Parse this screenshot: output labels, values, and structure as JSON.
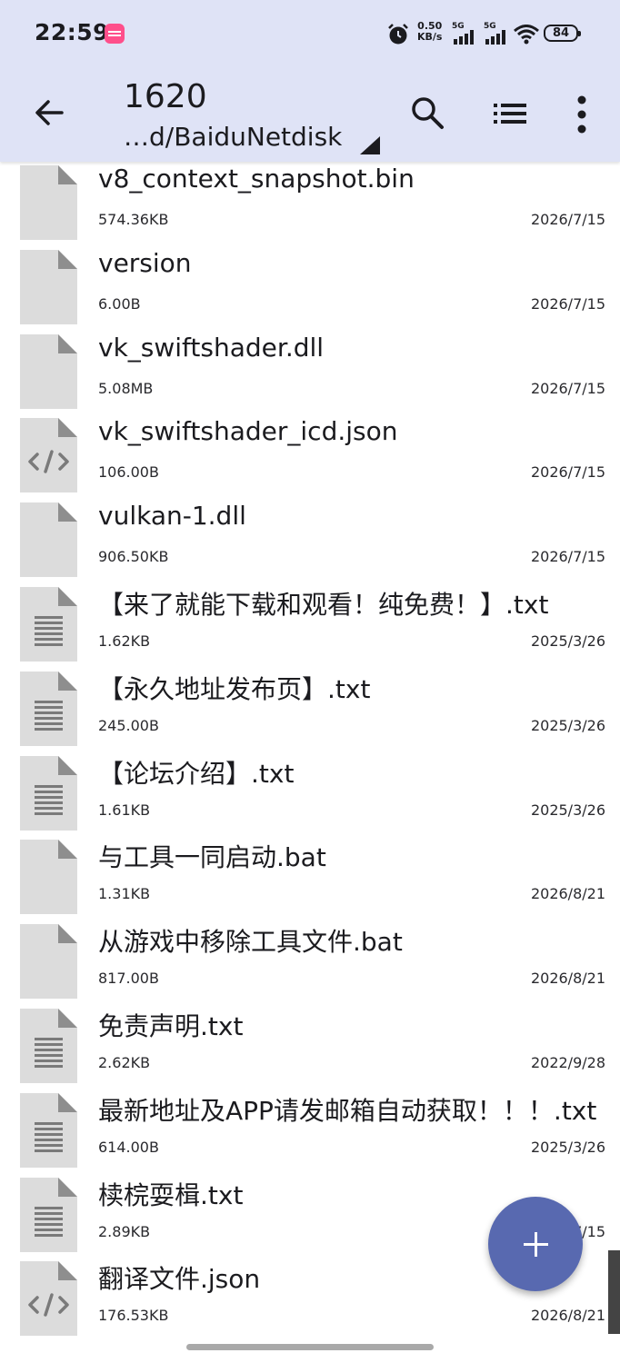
{
  "status_bar": {
    "time": "22:59",
    "net_speed_value": "0.50",
    "net_speed_unit": "KB/s",
    "sim1": "5G",
    "sim2": "5G",
    "battery": "84"
  },
  "toolbar": {
    "title": "1620",
    "path": "…d/BaiduNetdisk",
    "icons": [
      "back-arrow-icon",
      "search-icon",
      "list-view-icon",
      "more-vert-icon"
    ]
  },
  "files": [
    {
      "name": "v8_context_snapshot.bin",
      "size": "574.36KB",
      "date": "2026/7/15",
      "icon": "generic"
    },
    {
      "name": "version",
      "size": "6.00B",
      "date": "2026/7/15",
      "icon": "generic"
    },
    {
      "name": "vk_swiftshader.dll",
      "size": "5.08MB",
      "date": "2026/7/15",
      "icon": "generic"
    },
    {
      "name": "vk_swiftshader_icd.json",
      "size": "106.00B",
      "date": "2026/7/15",
      "icon": "code"
    },
    {
      "name": "vulkan-1.dll",
      "size": "906.50KB",
      "date": "2026/7/15",
      "icon": "generic"
    },
    {
      "name": "【来了就能下载和观看！纯免费！】.txt",
      "size": "1.62KB",
      "date": "2025/3/26",
      "icon": "text"
    },
    {
      "name": "【永久地址发布页】.txt",
      "size": "245.00B",
      "date": "2025/3/26",
      "icon": "text"
    },
    {
      "name": "【论坛介绍】.txt",
      "size": "1.61KB",
      "date": "2025/3/26",
      "icon": "text"
    },
    {
      "name": "与工具一同启动.bat",
      "size": "1.31KB",
      "date": "2026/8/21",
      "icon": "generic"
    },
    {
      "name": "从游戏中移除工具文件.bat",
      "size": "817.00B",
      "date": "2026/8/21",
      "icon": "generic"
    },
    {
      "name": "免责声明.txt",
      "size": "2.62KB",
      "date": "2022/9/28",
      "icon": "text"
    },
    {
      "name": "最新地址及APP请发邮箱自动获取！！！.txt",
      "size": "614.00B",
      "date": "2025/3/26",
      "icon": "text"
    },
    {
      "name": "椟梡耍楫.txt",
      "size": "2.89KB",
      "date": "7/15",
      "icon": "text"
    },
    {
      "name": "翻译文件.json",
      "size": "176.53KB",
      "date": "2026/8/21",
      "icon": "code"
    }
  ],
  "fab": {
    "icon": "add-icon"
  }
}
